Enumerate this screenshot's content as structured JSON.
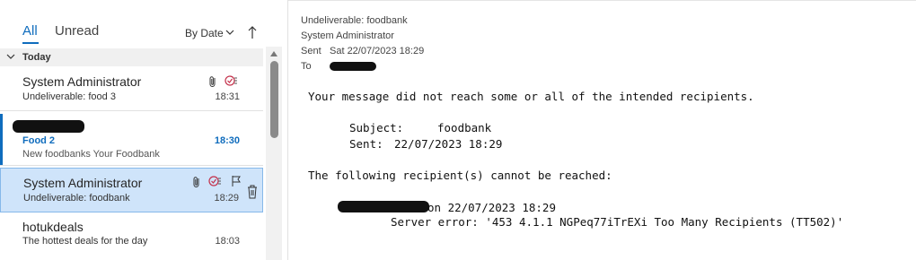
{
  "list": {
    "tabs": [
      {
        "label": "All",
        "active": true
      },
      {
        "label": "Unread",
        "active": false
      }
    ],
    "sort_label": "By Date",
    "group_label": "Today",
    "messages": [
      {
        "sender": "System Administrator",
        "subject": "Undeliverable: food 3",
        "time": "18:31",
        "icons": [
          "paperclip-icon",
          "voting-icon"
        ]
      },
      {
        "sender": "",
        "subject": "Food 2",
        "preview": "New foodbanks  Your Foodbank",
        "time": "18:30",
        "unread": true
      },
      {
        "sender": "System Administrator",
        "subject": "Undeliverable: foodbank",
        "time": "18:29",
        "selected": true,
        "icons": [
          "paperclip-icon",
          "voting-icon",
          "flag-icon",
          "delete-icon"
        ]
      },
      {
        "sender": "hotukdeals",
        "subject": "The hottest deals for the day",
        "time": "18:03"
      }
    ]
  },
  "reading": {
    "subject": "Undeliverable: foodbank",
    "from": "System Administrator",
    "sent_label": "Sent",
    "sent_value": "Sat 22/07/2023 18:29",
    "to_label": "To",
    "body": {
      "line1": "Your message did not reach some or all of the intended recipients.",
      "subject_label": "Subject:",
      "subject_value": "foodbank",
      "sent_label": "Sent:",
      "sent_value": "22/07/2023 18:29",
      "line_following": "The following recipient(s) cannot be reached:",
      "recipient_suffix": "on 22/07/2023 18:29",
      "server_error": "Server error: '453 4.1.1 NGPeq77iTrEXi Too Many Recipients (TT502)'"
    }
  },
  "colors": {
    "accent": "#0f6cbd",
    "selected_bg": "#cfe4fa",
    "redaction": "#111111"
  }
}
